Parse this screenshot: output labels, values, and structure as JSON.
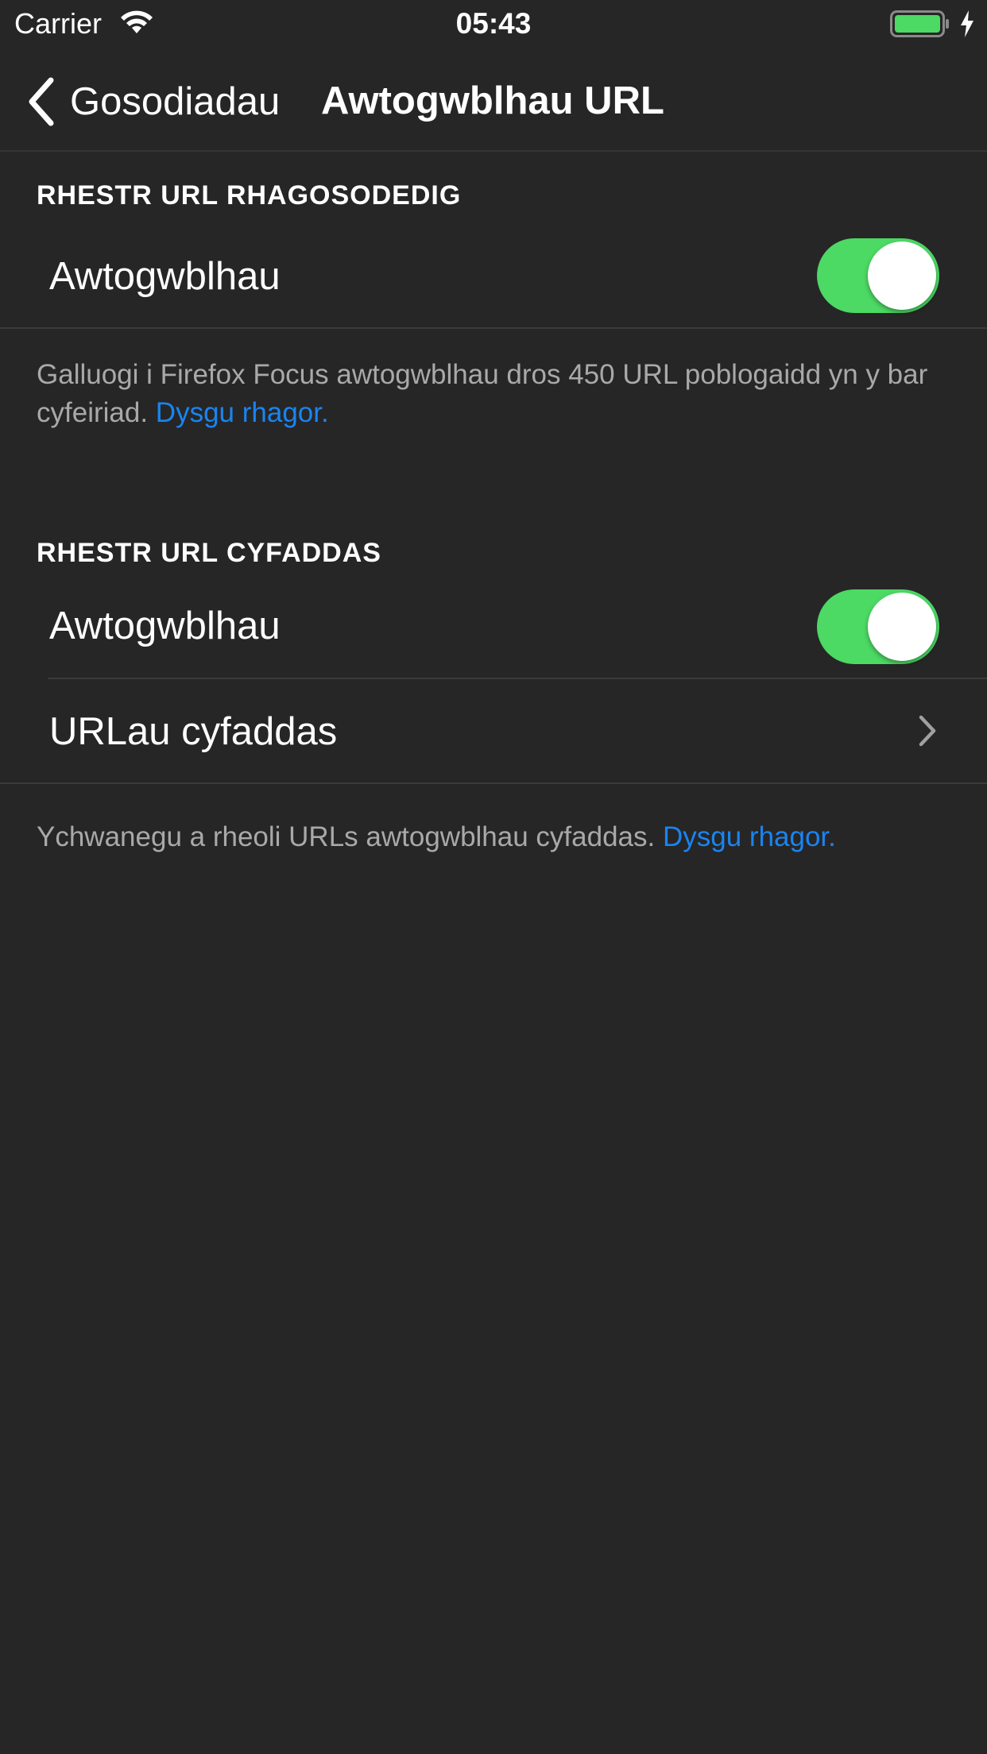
{
  "status_bar": {
    "carrier": "Carrier",
    "time": "05:43",
    "battery_level": 1.0,
    "charging": true,
    "icons": [
      "wifi-icon",
      "battery-icon",
      "charging-bolt-icon"
    ]
  },
  "nav": {
    "back_label": "Gosodiadau",
    "title": "Awtogwblhau URL"
  },
  "sections": [
    {
      "header": "RHESTR URL RHAGOSODEDIG",
      "rows": [
        {
          "label": "Awtogwblhau",
          "toggle_on": true
        }
      ],
      "footer": "Galluogi i Firefox Focus awtogwblhau dros 450 URL poblogaidd yn y bar cyfeiriad.",
      "footer_link": "Dysgu rhagor."
    },
    {
      "header": "RHESTR URL CYFADDAS",
      "rows": [
        {
          "label": "Awtogwblhau",
          "toggle_on": true
        },
        {
          "label": "URLau cyfaddas",
          "disclosure": "chevron-right-icon"
        }
      ],
      "footer": "Ychwanegu a rheoli URLs awtogwblhau cyfaddas.",
      "footer_link": "Dysgu rhagor."
    }
  ],
  "colors": {
    "background": "#262626",
    "toggle_on": "#4cd964",
    "link": "#1a84f0",
    "secondary_text": "#a9a9a9"
  }
}
